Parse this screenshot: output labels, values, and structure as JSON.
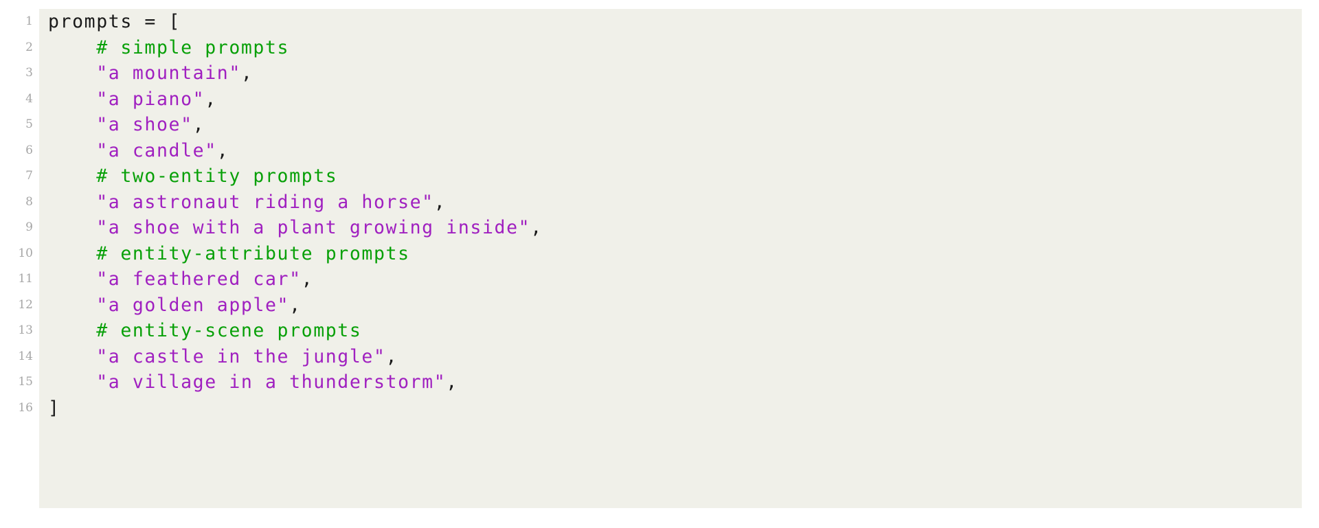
{
  "code_block": {
    "language": "python",
    "background_color": "#f0f0e9",
    "page_background_color": "#ffffff",
    "gutter_color": "#a6a6a6",
    "syntax_colors": {
      "plain": "#1a1a1a",
      "comment": "#08a008",
      "string": "#a020c0"
    },
    "lines": [
      {
        "number": "1",
        "tokens": [
          {
            "text": "prompts = [",
            "type": "plain"
          }
        ]
      },
      {
        "number": "2",
        "tokens": [
          {
            "text": "    ",
            "type": "plain"
          },
          {
            "text": "# simple prompts",
            "type": "comment"
          }
        ]
      },
      {
        "number": "3",
        "tokens": [
          {
            "text": "    ",
            "type": "plain"
          },
          {
            "text": "\"a mountain\"",
            "type": "string"
          },
          {
            "text": ",",
            "type": "plain"
          }
        ]
      },
      {
        "number": "4",
        "tokens": [
          {
            "text": "    ",
            "type": "plain"
          },
          {
            "text": "\"a piano\"",
            "type": "string"
          },
          {
            "text": ",",
            "type": "plain"
          }
        ]
      },
      {
        "number": "5",
        "tokens": [
          {
            "text": "    ",
            "type": "plain"
          },
          {
            "text": "\"a shoe\"",
            "type": "string"
          },
          {
            "text": ",",
            "type": "plain"
          }
        ]
      },
      {
        "number": "6",
        "tokens": [
          {
            "text": "    ",
            "type": "plain"
          },
          {
            "text": "\"a candle\"",
            "type": "string"
          },
          {
            "text": ",",
            "type": "plain"
          }
        ]
      },
      {
        "number": "7",
        "tokens": [
          {
            "text": "    ",
            "type": "plain"
          },
          {
            "text": "# two-entity prompts",
            "type": "comment"
          }
        ]
      },
      {
        "number": "8",
        "tokens": [
          {
            "text": "    ",
            "type": "plain"
          },
          {
            "text": "\"a astronaut riding a horse\"",
            "type": "string"
          },
          {
            "text": ",",
            "type": "plain"
          }
        ]
      },
      {
        "number": "9",
        "tokens": [
          {
            "text": "    ",
            "type": "plain"
          },
          {
            "text": "\"a shoe with a plant growing inside\"",
            "type": "string"
          },
          {
            "text": ",",
            "type": "plain"
          }
        ]
      },
      {
        "number": "10",
        "tokens": [
          {
            "text": "    ",
            "type": "plain"
          },
          {
            "text": "# entity-attribute prompts",
            "type": "comment"
          }
        ]
      },
      {
        "number": "11",
        "tokens": [
          {
            "text": "    ",
            "type": "plain"
          },
          {
            "text": "\"a feathered car\"",
            "type": "string"
          },
          {
            "text": ",",
            "type": "plain"
          }
        ]
      },
      {
        "number": "12",
        "tokens": [
          {
            "text": "    ",
            "type": "plain"
          },
          {
            "text": "\"a golden apple\"",
            "type": "string"
          },
          {
            "text": ",",
            "type": "plain"
          }
        ]
      },
      {
        "number": "13",
        "tokens": [
          {
            "text": "    ",
            "type": "plain"
          },
          {
            "text": "# entity-scene prompts",
            "type": "comment"
          }
        ]
      },
      {
        "number": "14",
        "tokens": [
          {
            "text": "    ",
            "type": "plain"
          },
          {
            "text": "\"a castle in the jungle\"",
            "type": "string"
          },
          {
            "text": ",",
            "type": "plain"
          }
        ]
      },
      {
        "number": "15",
        "tokens": [
          {
            "text": "    ",
            "type": "plain"
          },
          {
            "text": "\"a village in a thunderstorm\"",
            "type": "string"
          },
          {
            "text": ",",
            "type": "plain"
          }
        ]
      },
      {
        "number": "16",
        "tokens": [
          {
            "text": "]",
            "type": "plain"
          }
        ]
      }
    ]
  }
}
